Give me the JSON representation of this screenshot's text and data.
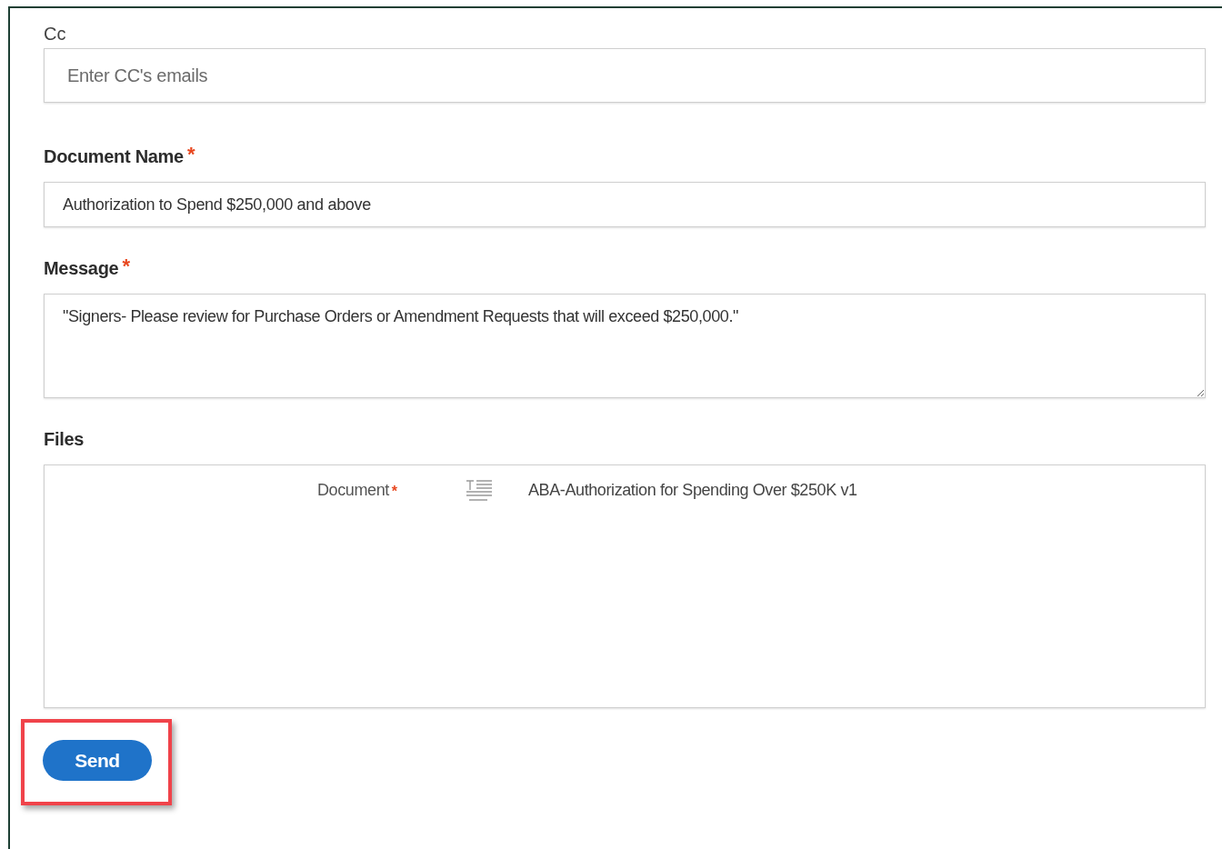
{
  "fields": [
    {
      "kind": "input",
      "label": "Cc",
      "placeholder": "Enter CC's emails"
    },
    {
      "kind": "input",
      "label": "Document Name",
      "required_mark": "*",
      "value": "Authorization to Spend $250,000 and above"
    },
    {
      "kind": "textarea",
      "label": "Message",
      "required_mark": "*",
      "value": "\"Signers- Please review for Purchase Orders or Amendment Requests that will exceed $250,000.\""
    },
    {
      "kind": "files",
      "label": "Files",
      "files": [
        {
          "label": "Document",
          "required_mark": "*",
          "name": "ABA-Authorization for Spending Over $250K v1"
        }
      ]
    }
  ],
  "send_button": {
    "label": "Send",
    "highlighted": true
  }
}
